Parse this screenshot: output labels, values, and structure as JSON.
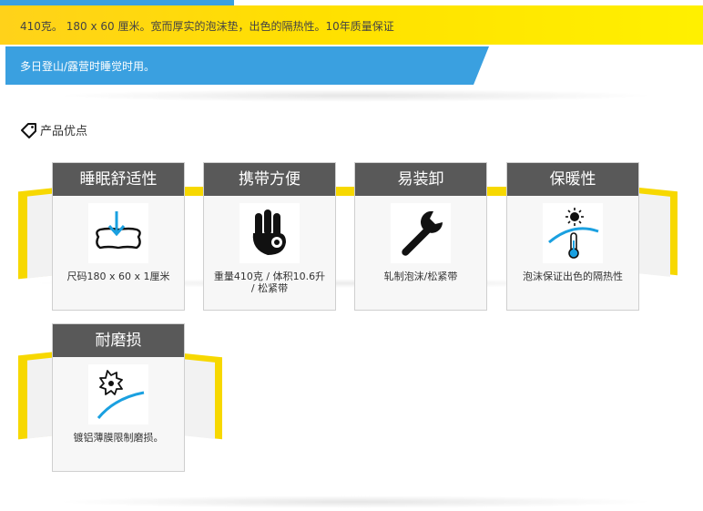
{
  "banner": {
    "spec_line": "410克。 180 x 60 厘米。宽而厚实的泡沫垫，出色的隔热性。10年质量保证",
    "usage_line": "多日登山/露营时睡觉时用。"
  },
  "section": {
    "title": "产品优点",
    "icon": "price-tag-icon"
  },
  "features": [
    {
      "title": "睡眠舒适性",
      "icon": "pillow-arrow-icon",
      "desc": "尺码180 x 60 x 1厘米"
    },
    {
      "title": "携带方便",
      "icon": "ok-hand-icon",
      "desc": "重量410克 / 体积10.6升 / 松紧带"
    },
    {
      "title": "易装卸",
      "icon": "wrench-icon",
      "desc": "轧制泡沫/松紧带"
    },
    {
      "title": "保暖性",
      "icon": "thermometer-sun-icon",
      "desc": "泡沫保证出色的隔热性"
    },
    {
      "title": "耐磨损",
      "icon": "saw-blade-icon",
      "desc": "镀铝薄膜限制磨损。"
    }
  ],
  "colors": {
    "yellow": "#ffe000",
    "blue": "#3aa0e0",
    "title_bg": "#595959",
    "icon_accent": "#1aa0e0"
  }
}
